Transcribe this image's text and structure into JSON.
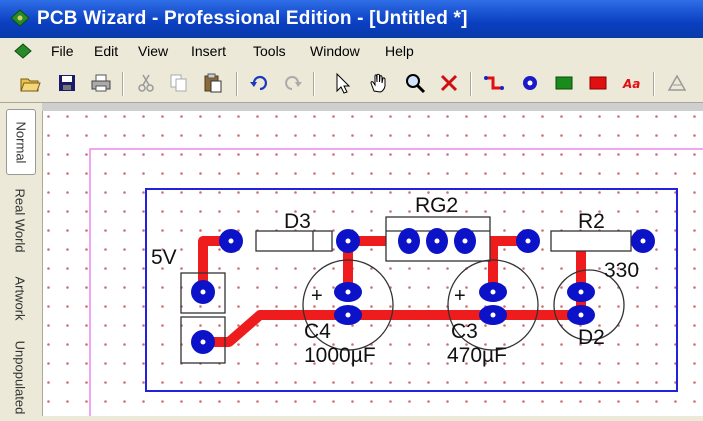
{
  "window": {
    "title": "PCB Wizard - Professional Edition - [Untitled *]"
  },
  "menu": [
    "File",
    "Edit",
    "View",
    "Insert",
    "Tools",
    "Window",
    "Help"
  ],
  "toolbar": [
    "open-icon",
    "save-icon",
    "print-icon",
    "cut-icon",
    "copy-icon",
    "paste-icon",
    "undo-icon",
    "redo-icon",
    "select-arrow-icon",
    "hand-icon",
    "zoom-icon",
    "delete-icon",
    "track-icon",
    "pad-icon",
    "component-icon",
    "copper-area-icon",
    "text-icon",
    "properties-icon"
  ],
  "sidebar_tabs": [
    "Normal",
    "Real World",
    "Artwork",
    "Unpopulated"
  ],
  "components": {
    "d3": "D3",
    "rg2": "RG2",
    "r2": "R2",
    "r2_value": "330",
    "supply": "5V",
    "c4": "C4",
    "c4_value": "1000µF",
    "c3": "C3",
    "c3_value": "470µF",
    "d2": "D2",
    "plus": "+"
  },
  "colors": {
    "track": "#ee1c1c",
    "pad": "#0b12c8",
    "board_outline": "#2222dd",
    "page_border": "#ee88ee",
    "titlebar": "#0a3fc1"
  }
}
